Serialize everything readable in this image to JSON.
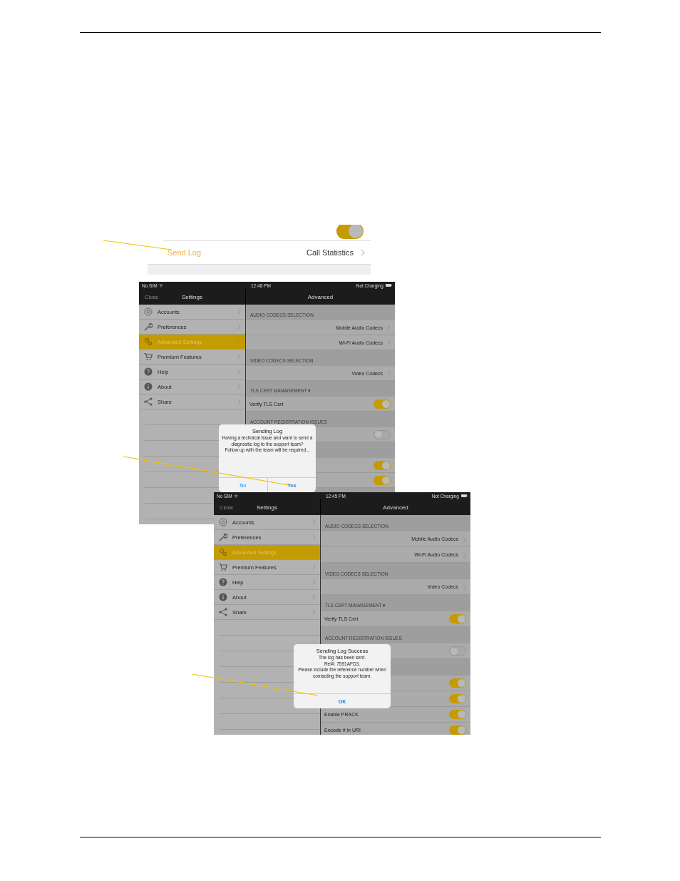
{
  "strip": {
    "toggle_on": true,
    "action": "Send Log",
    "link": "Call Statistics"
  },
  "screens": [
    {
      "status": {
        "carrier": "No SIM",
        "time": "12:48 PM",
        "battery": "Not Charging"
      },
      "close": "Close",
      "left_title": "Settings",
      "right_title": "Advanced",
      "menu": [
        {
          "label": "Accounts",
          "selected": false
        },
        {
          "label": "Preferences",
          "selected": false
        },
        {
          "label": "Advanced Settings",
          "selected": true
        },
        {
          "label": "Premium Features",
          "selected": false
        },
        {
          "label": "Help",
          "selected": false
        },
        {
          "label": "About",
          "selected": false
        },
        {
          "label": "Share",
          "selected": false
        }
      ],
      "rows": [
        {
          "kind": "header",
          "label": "AUDIO CODECS SELECTION"
        },
        {
          "kind": "link",
          "label": "Mobile Audio Codecs"
        },
        {
          "kind": "link",
          "label": "Wi-Fi Audio Codecs"
        },
        {
          "kind": "header",
          "label": "VIDEO CODECS SELECTION"
        },
        {
          "kind": "link",
          "label": "Video Codecs"
        },
        {
          "kind": "header",
          "label": "TLS CERT MANAGEMENT ▾"
        },
        {
          "kind": "toggle",
          "label": "Verify TLS Cert",
          "on": true
        },
        {
          "kind": "header",
          "label": "ACCOUNT REGISTRATION ISSUES"
        },
        {
          "kind": "toggle",
          "on": false
        },
        {
          "kind": "header"
        },
        {
          "kind": "toggle",
          "on": true
        },
        {
          "kind": "toggle",
          "on": true
        }
      ],
      "dialog": {
        "title": "Sending Log",
        "message": [
          "Having a technical issue and want to send a diagnostic log to the support team?",
          "Follow up with the team will be required..."
        ],
        "buttons": [
          "No",
          "Yes"
        ]
      }
    },
    {
      "status": {
        "carrier": "No SIM",
        "time": "12:45 PM",
        "battery": "Not Charging"
      },
      "close": "Close",
      "left_title": "Settings",
      "right_title": "Advanced",
      "menu": [
        {
          "label": "Accounts",
          "selected": false
        },
        {
          "label": "Preferences",
          "selected": false
        },
        {
          "label": "Advanced Settings",
          "selected": true
        },
        {
          "label": "Premium Features",
          "selected": false
        },
        {
          "label": "Help",
          "selected": false
        },
        {
          "label": "About",
          "selected": false
        },
        {
          "label": "Share",
          "selected": false
        }
      ],
      "rows": [
        {
          "kind": "header",
          "label": "AUDIO CODECS SELECTION"
        },
        {
          "kind": "link",
          "label": "Mobile Audio Codecs"
        },
        {
          "kind": "link",
          "label": "Wi-Fi Audio Codecs"
        },
        {
          "kind": "header",
          "label": "VIDEO CODECS SELECTION"
        },
        {
          "kind": "link",
          "label": "Video Codecs"
        },
        {
          "kind": "header",
          "label": "TLS CERT MANAGEMENT ▾"
        },
        {
          "kind": "toggle",
          "label": "Verify TLS Cert",
          "on": true
        },
        {
          "kind": "header",
          "label": "ACCOUNT REGISTRATION ISSUES"
        },
        {
          "kind": "toggle",
          "on": false
        },
        {
          "kind": "header"
        },
        {
          "kind": "toggle",
          "on": true
        },
        {
          "kind": "toggle",
          "on": true
        },
        {
          "kind": "toggle",
          "label": "Enable PRACK",
          "on": true
        },
        {
          "kind": "toggle",
          "label": "Encode # in URI",
          "on": true
        }
      ],
      "dialog": {
        "title": "Sending Log Success",
        "message": [
          "The log has been sent.",
          "Ref#: 7591AFD3.",
          "Please include the reference number when contacting the support team."
        ],
        "buttons": [
          "OK"
        ]
      }
    }
  ]
}
